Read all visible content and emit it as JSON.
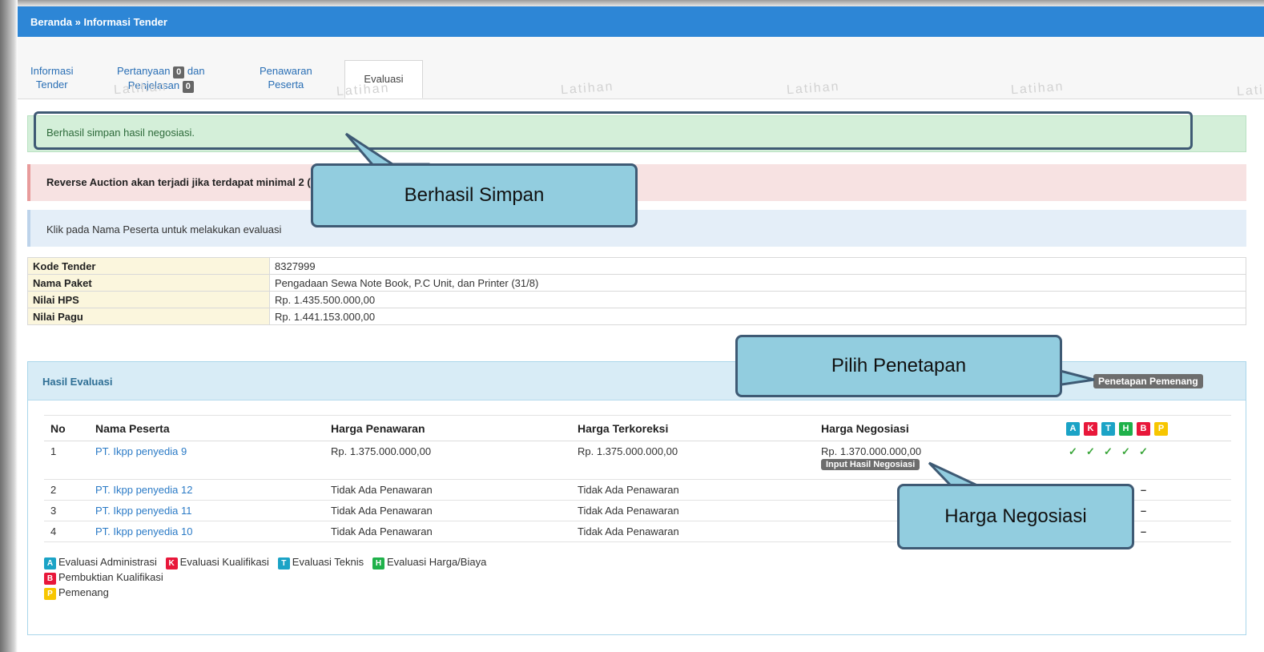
{
  "breadcrumb": "Beranda » Informasi Tender",
  "tabs": {
    "informasi": [
      "Informasi",
      "Tender"
    ],
    "pertanyaan_a": "Pertanyaan",
    "pertanyaan_count": "0",
    "pertanyaan_b": "dan",
    "penjelasan": "Penjelasan",
    "penjelasan_count": "0",
    "penawaran": [
      "Penawaran",
      "Peserta"
    ],
    "evaluasi": "Evaluasi"
  },
  "watermark": "Latihan",
  "alerts": {
    "success": "Berhasil simpan hasil negosiasi.",
    "warning": "Reverse Auction akan terjadi jika terdapat minimal 2 (dua) Peserta yang lulus sampai dengan Pembuktian Kualifikasi.",
    "info": "Klik pada Nama Peserta untuk melakukan evaluasi"
  },
  "info": [
    {
      "label": "Kode Tender",
      "value": "8327999"
    },
    {
      "label": "Nama Paket",
      "value": "Pengadaan Sewa Note Book, P.C Unit, dan Printer (31/8)"
    },
    {
      "label": "Nilai HPS",
      "value": "Rp. 1.435.500.000,00"
    },
    {
      "label": "Nilai Pagu",
      "value": "Rp. 1.441.153.000,00"
    }
  ],
  "panel": {
    "title": "Hasil Evaluasi",
    "btn_penetapan": "Penetapan Pemenang",
    "headers": {
      "no": "No",
      "nama": "Nama Peserta",
      "penawaran": "Harga Penawaran",
      "terkoreksi": "Harga Terkoreksi",
      "negosiasi": "Harga Negosiasi"
    },
    "letters": [
      {
        "l": "A",
        "color": "#1ba3c6"
      },
      {
        "l": "K",
        "color": "#e8173a"
      },
      {
        "l": "T",
        "color": "#1ba3c6"
      },
      {
        "l": "H",
        "color": "#1fb14a"
      },
      {
        "l": "B",
        "color": "#e8173a"
      },
      {
        "l": "P",
        "color": "#f7c600"
      }
    ],
    "rows": [
      {
        "no": "1",
        "nama": "PT. Ikpp penyedia 9",
        "penawaran": "Rp. 1.375.000.000,00",
        "terkoreksi": "Rp. 1.375.000.000,00",
        "negosiasi": "Rp. 1.370.000.000,00",
        "btn": "Input Hasil Negosiasi"
      },
      {
        "no": "2",
        "nama": "PT. Ikpp penyedia 12",
        "penawaran": "Tidak Ada Penawaran",
        "terkoreksi": "Tidak Ada Penawaran"
      },
      {
        "no": "3",
        "nama": "PT. Ikpp penyedia 11",
        "penawaran": "Tidak Ada Penawaran",
        "terkoreksi": "Tidak Ada Penawaran"
      },
      {
        "no": "4",
        "nama": "PT. Ikpp penyedia 10",
        "penawaran": "Tidak Ada Penawaran",
        "terkoreksi": "Tidak Ada Penawaran"
      }
    ],
    "legend": {
      "a": "Evaluasi Administrasi",
      "k": "Evaluasi Kualifikasi",
      "t": "Evaluasi Teknis",
      "h": "Evaluasi Harga/Biaya",
      "b": "Pembuktian Kualifikasi",
      "p": "Pemenang"
    }
  },
  "callouts": {
    "berhasil": "Berhasil Simpan",
    "pilih": "Pilih Penetapan",
    "harga": "Harga Negosiasi"
  }
}
